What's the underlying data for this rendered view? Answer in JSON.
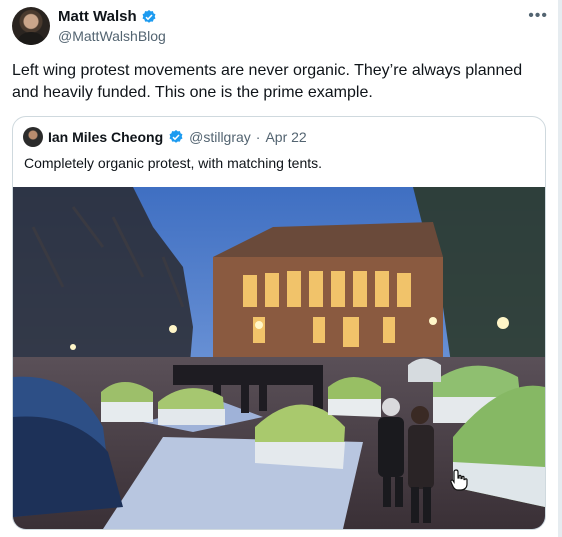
{
  "author": {
    "name": "Matt Walsh",
    "handle": "@MattWalshBlog",
    "verified": true
  },
  "menu_icon": "more-horizontal-icon",
  "tweet_text": "Left wing protest movements are never organic. They’re always planned and heavily funded. This one is the prime example.",
  "quoted_tweet": {
    "author_name": "Ian Miles Cheong",
    "handle": "@stillgray",
    "separator": "·",
    "date": "Apr 22",
    "verified": true,
    "text": "Completely organic protest, with matching tents.",
    "image_subject": "tents-photo"
  },
  "colors": {
    "verified_blue": "#1d9bf0",
    "secondary_text": "#536471",
    "border": "#cfd9de"
  }
}
